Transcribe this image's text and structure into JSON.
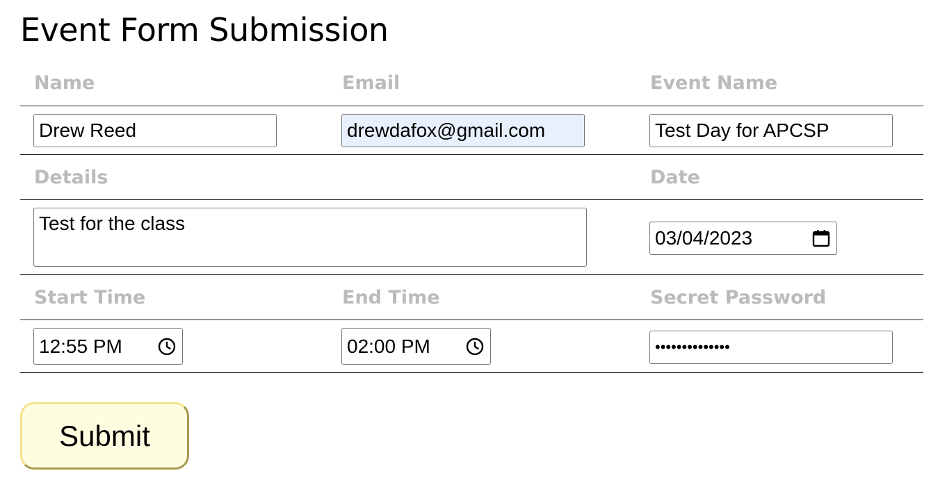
{
  "page": {
    "title": "Event Form Submission"
  },
  "form": {
    "name": {
      "label": "Name",
      "value": "Drew Reed"
    },
    "email": {
      "label": "Email",
      "value": "drewdafox@gmail.com",
      "autofill_bg": "#e8f0fe"
    },
    "event_name": {
      "label": "Event Name",
      "value": "Test Day for APCSP"
    },
    "details": {
      "label": "Details",
      "value": "Test for the class"
    },
    "date": {
      "label": "Date",
      "value": "03/04/2023",
      "icon": "calendar-icon"
    },
    "start_time": {
      "label": "Start Time",
      "value": "12:55 PM",
      "icon": "clock-icon"
    },
    "end_time": {
      "label": "End Time",
      "value": "02:00 PM",
      "icon": "clock-icon"
    },
    "secret_password": {
      "label": "Secret Password",
      "value": "••••••••••••••"
    }
  },
  "submit": {
    "label": "Submit",
    "background": "#fffde0",
    "border_light": "#f2e38a",
    "border_dark": "#a59a4e"
  },
  "colors": {
    "label_text": "#bbbbbb",
    "rule": "#222222",
    "input_border": "#767676"
  }
}
